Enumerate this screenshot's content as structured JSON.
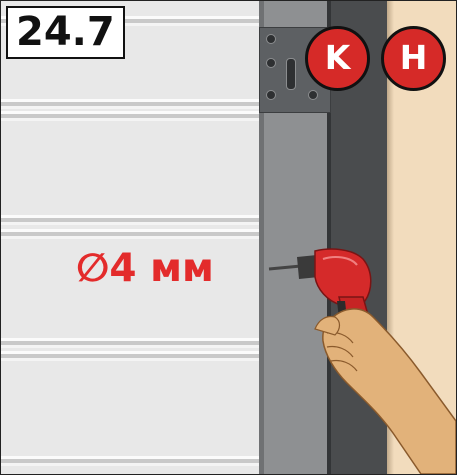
{
  "step": {
    "label": "24.7"
  },
  "badges": [
    {
      "letter": "K"
    },
    {
      "letter": "H"
    }
  ],
  "drill_spec": {
    "diameter": "∅4 мм"
  },
  "icons": {
    "drill": "cordless-drill-icon",
    "hand": "hand-icon",
    "bracket": "mounting-bracket-icon"
  },
  "colors": {
    "accent_red": "#d62a28",
    "label_red": "#e32b2b",
    "rail_gray": "#8e9092",
    "wall_beige": "#f2dcbd"
  }
}
